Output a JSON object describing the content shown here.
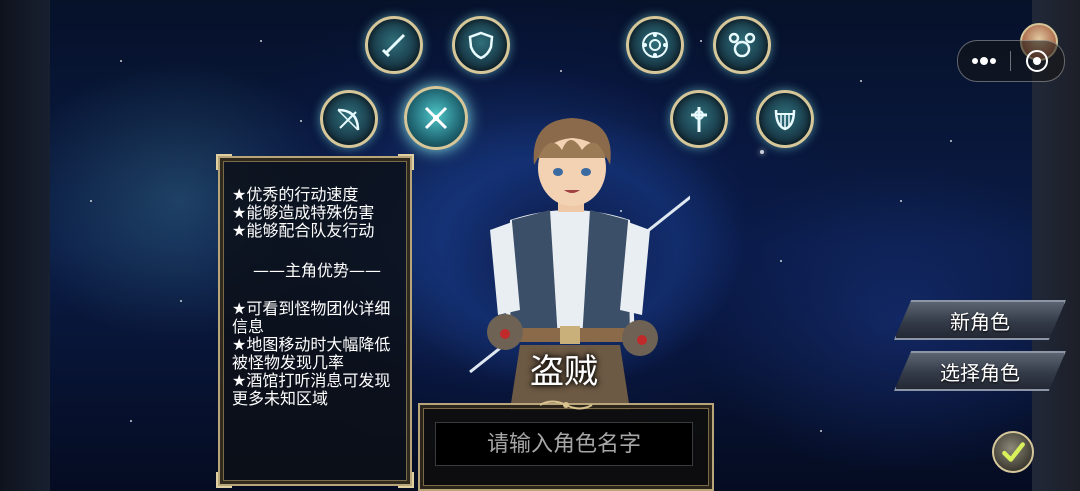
{
  "class_icons": [
    {
      "id": "sword",
      "icon": "sword-icon",
      "selected": false
    },
    {
      "id": "shield",
      "icon": "shield-icon",
      "selected": false
    },
    {
      "id": "bow",
      "icon": "bow-icon",
      "selected": false
    },
    {
      "id": "rogue",
      "icon": "crossed-daggers-icon",
      "selected": true
    },
    {
      "id": "mage",
      "icon": "magic-circle-icon",
      "selected": false
    },
    {
      "id": "paw",
      "icon": "paw-icon",
      "selected": false
    },
    {
      "id": "priest",
      "icon": "cross-icon",
      "selected": false
    },
    {
      "id": "bard",
      "icon": "lyre-icon",
      "selected": false
    }
  ],
  "info_panel": {
    "traits": [
      "★优秀的行动速度",
      "★能够造成特殊伤害",
      "★能够配合队友行动"
    ],
    "divider": "——主角优势——",
    "advantages": [
      "★可看到怪物团伙详细信息",
      "★地图移动时大幅降低被怪物发现几率",
      "★酒馆打听消息可发现更多未知区域"
    ]
  },
  "character": {
    "class_name": "盗贼"
  },
  "name_input": {
    "placeholder": "请输入角色名字",
    "value": ""
  },
  "buttons": {
    "new_character": "新角色",
    "select_character": "选择角色"
  },
  "capsule": {
    "more_icon": "more-dots-icon",
    "close_icon": "record-circle-icon"
  },
  "colors": {
    "frame_gold": "#b9a57a",
    "icon_glow": "#82e6e6"
  }
}
